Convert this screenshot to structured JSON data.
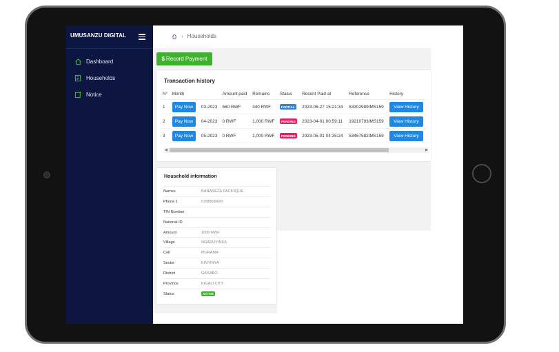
{
  "app": {
    "title": "UMUSANZU DIGITAL"
  },
  "sidebar": {
    "items": [
      {
        "label": "Dashboard",
        "icon": "home-icon"
      },
      {
        "label": "Households",
        "icon": "households-icon"
      },
      {
        "label": "Notice",
        "icon": "notice-icon"
      }
    ]
  },
  "breadcrumb": {
    "current": "Households"
  },
  "toolbar": {
    "record_label": "Record Payment"
  },
  "transactions": {
    "title": "Transaction history",
    "headers": [
      "N°",
      "Month",
      "Amount paid",
      "Remains",
      "Status",
      "Recent Paid at",
      "Reference",
      "History"
    ],
    "pay_label": "Pay Now",
    "history_label": "View History",
    "rows": [
      {
        "no": "1",
        "month": "03-2023",
        "amount": "660 RWF",
        "remains": "340 RWF",
        "status": "PARTIAL",
        "paid_at": "2023-06-27 15:21:34",
        "reference": "63302989IMS159"
      },
      {
        "no": "2",
        "month": "04-2023",
        "amount": "0 RWF",
        "remains": "1,000 RWF",
        "status": "PENDING",
        "paid_at": "2023-04-01 00:59:11",
        "reference": "19210793IMS159"
      },
      {
        "no": "3",
        "month": "05-2023",
        "amount": "0 RWF",
        "remains": "1,000 RWF",
        "status": "PENDING",
        "paid_at": "2023-05-01 04:35:24",
        "reference": "53467582IMS159"
      }
    ]
  },
  "household": {
    "title": "Household information",
    "fields": [
      {
        "label": "Names",
        "value": "BANANEZA PACIFIQUE"
      },
      {
        "label": "Phone 1",
        "value": "0788509426"
      },
      {
        "label": "TIN Number",
        "value": ""
      },
      {
        "label": "National ID",
        "value": ""
      },
      {
        "label": "Amount",
        "value": "1000 RWF"
      },
      {
        "label": "Village",
        "value": "NGARUYINKA"
      },
      {
        "label": "Cell",
        "value": "MURAMA"
      },
      {
        "label": "Sector",
        "value": "KINYINYA"
      },
      {
        "label": "District",
        "value": "GASABO"
      },
      {
        "label": "Province",
        "value": "KIGALI CITY"
      },
      {
        "label": "Status",
        "value": "ACTIVE"
      }
    ]
  },
  "colors": {
    "sidebar": "#0c1640",
    "accent_green": "#3fb12f",
    "accent_blue": "#1e88e5",
    "pending": "#e91e63"
  }
}
